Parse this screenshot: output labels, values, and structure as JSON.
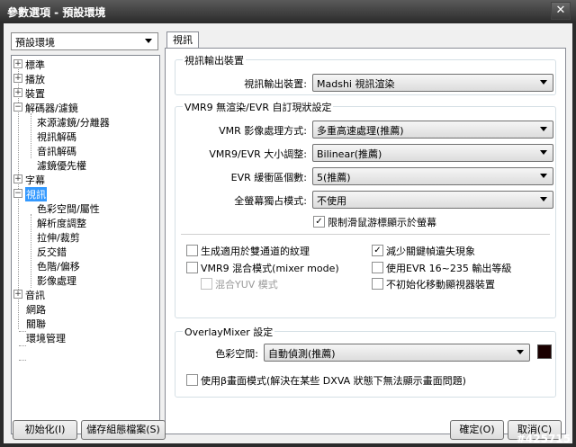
{
  "window": {
    "title": "參數選項 - 預設環境",
    "close_glyph": "✕"
  },
  "profile_select": {
    "value": "預設環境"
  },
  "tree": {
    "expand_glyph": "+",
    "collapse_glyph": "−",
    "items": [
      {
        "label": "標準"
      },
      {
        "label": "播放"
      },
      {
        "label": "裝置"
      },
      {
        "label": "解碼器/濾鏡",
        "children": [
          "來源濾鏡/分離器",
          "視訊解碼",
          "音訊解碼",
          "濾鏡優先權"
        ]
      },
      {
        "label": "字幕"
      },
      {
        "label": "視訊",
        "children": [
          "色彩空間/屬性",
          "解析度調整",
          "拉伸/裁剪",
          "反交錯",
          "色階/偏移",
          "影像處理"
        ]
      },
      {
        "label": "音訊"
      },
      {
        "label": "網路"
      },
      {
        "label": "關聯"
      },
      {
        "label": "環境管理"
      }
    ]
  },
  "tab": {
    "label": "視訊"
  },
  "output_group": {
    "legend": "視訊輸出裝置",
    "device_label": "視訊輸出裝置:",
    "device_value": "Madshi 視訊渲染"
  },
  "vmr_group": {
    "legend": "VMR9 無渲染/EVR 自訂現狀設定",
    "rows": [
      {
        "label": "VMR 影像處理方式:",
        "value": "多重高速處理(推薦)"
      },
      {
        "label": "VMR9/EVR 大小調整:",
        "value": "Bilinear(推薦)"
      },
      {
        "label": "EVR 緩衝區個數:",
        "value": "5(推薦)"
      },
      {
        "label": "全螢幕獨占模式:",
        "value": "不使用"
      }
    ],
    "limit_checkbox": {
      "label": "限制滑鼠游標顯示於螢幕",
      "checked": true
    },
    "checkboxes": [
      {
        "label": "生成適用於雙通道的紋理",
        "checked": false,
        "disabled": false
      },
      {
        "label": "減少關鍵幀遺失現象",
        "checked": true,
        "disabled": false
      },
      {
        "label": "VMR9 混合模式(mixer mode)",
        "checked": false,
        "disabled": false
      },
      {
        "label": "使用EVR 16~235 輸出等級",
        "checked": false,
        "disabled": false
      },
      {
        "label": "混合YUV 模式",
        "checked": false,
        "disabled": true
      },
      {
        "label": "不初始化移動顯視器裝置",
        "checked": false,
        "disabled": false
      }
    ]
  },
  "overlay_group": {
    "legend": "OverlayMixer 設定",
    "colorspace_label": "色彩空間:",
    "colorspace_value": "自動偵測(推薦)",
    "color_swatch": "#1a0000",
    "beta_checkbox": {
      "label": "使用β畫面模式(解決在某些 DXVA 狀態下無法顯示畫面問題)",
      "checked": false
    }
  },
  "buttons": {
    "init": "初始化(I)",
    "save_profile": "儲存組態檔案(S)",
    "ok": "確定(O)",
    "cancel": "取消(C)"
  },
  "check_glyph": "✓",
  "watermark": "#425715"
}
